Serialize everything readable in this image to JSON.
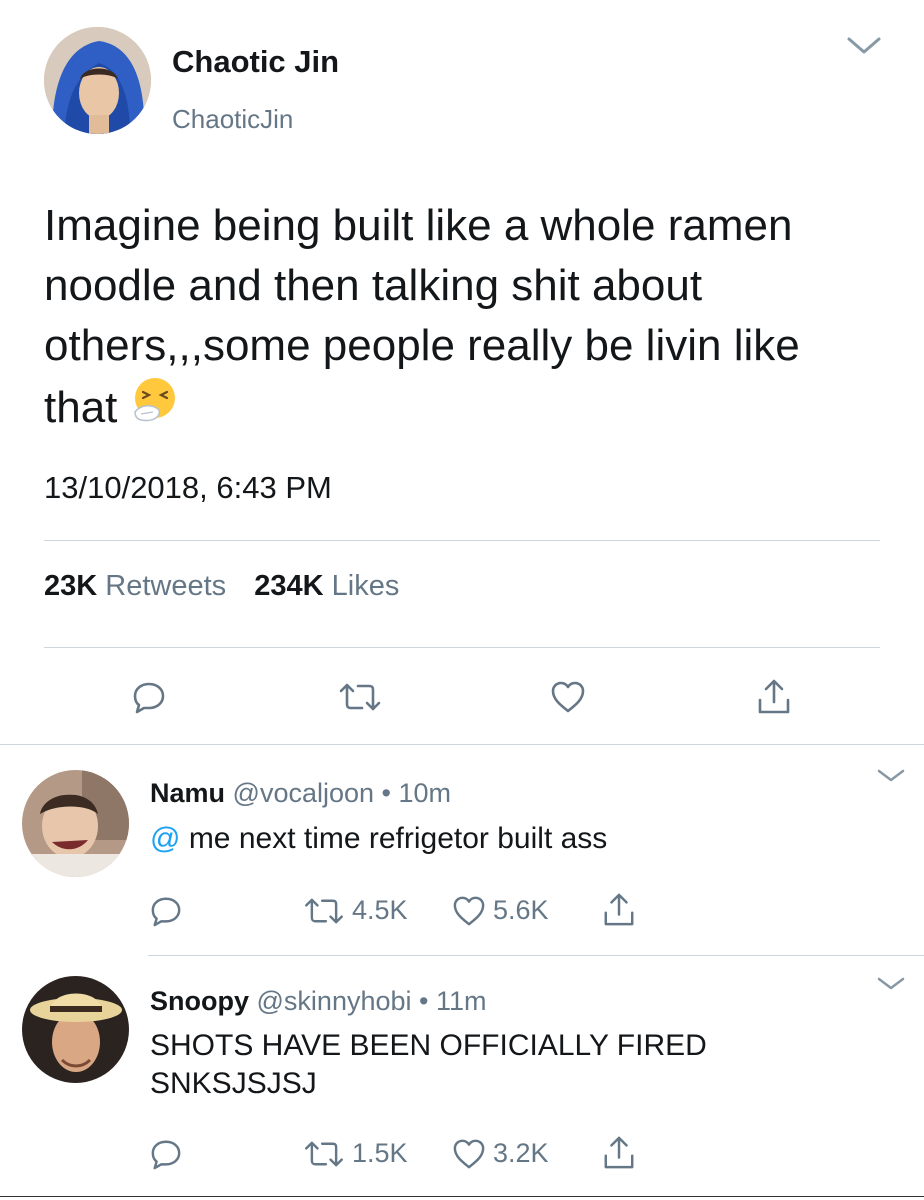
{
  "main_tweet": {
    "author_name": "Chaotic Jin",
    "author_handle": "ChaoticJin",
    "text_lines": [
      "Imagine being built like a whole ramen",
      "noodle and then talking shit about",
      "others,,,some people really be livin like",
      "that"
    ],
    "emoji": "sneezing-face",
    "timestamp": "13/10/2018, 6:43 PM",
    "retweets_count": "23K",
    "retweets_label": "Retweets",
    "likes_count": "234K",
    "likes_label": "Likes"
  },
  "replies": [
    {
      "name": "Namu",
      "handle": "@vocaljoon",
      "dot": "•",
      "time": "10m",
      "mention": "@",
      "text_lines": [
        "me next time refrigetor built ass"
      ],
      "retweets": "4.5K",
      "likes": "5.6K"
    },
    {
      "name": "Snoopy",
      "handle": "@skinnyhobi",
      "dot": "•",
      "time": "11m",
      "text_lines": [
        "SHOTS HAVE BEEN OFFICIALLY FIRED",
        "SNKSJSJSJ"
      ],
      "retweets": "1.5K",
      "likes": "3.2K"
    }
  ],
  "colors": {
    "text": "#14171a",
    "muted": "#657786",
    "link": "#1da1f2",
    "divider": "#ccd6dd"
  }
}
